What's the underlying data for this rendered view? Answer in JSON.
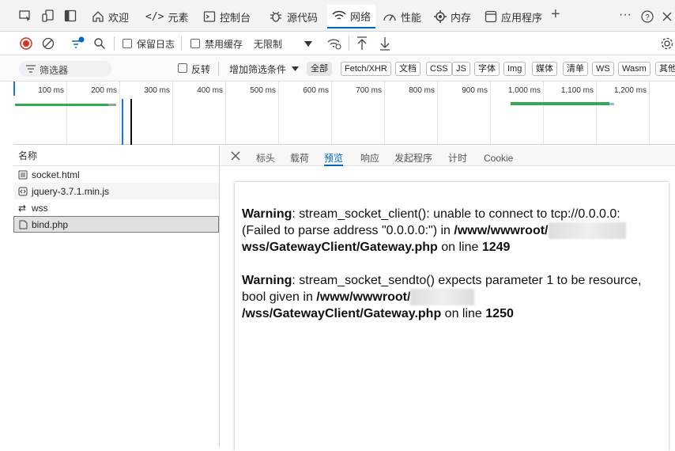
{
  "tabs": [
    {
      "label": "欢迎",
      "icon": "home-icon"
    },
    {
      "label": "元素",
      "icon": "code-icon"
    },
    {
      "label": "控制台",
      "icon": "console-icon"
    },
    {
      "label": "源代码",
      "icon": "bug-icon"
    },
    {
      "label": "网络",
      "icon": "wifi-icon",
      "active": true
    },
    {
      "label": "性能",
      "icon": "performance-icon"
    },
    {
      "label": "内存",
      "icon": "memory-icon"
    },
    {
      "label": "应用程序",
      "icon": "application-icon"
    }
  ],
  "toolbar": {
    "preserve_log": "保留日志",
    "disable_cache": "禁用缓存",
    "throttle": "无限制"
  },
  "filterbar": {
    "filter_placeholder": "筛选器",
    "invert": "反转",
    "more_filters": "增加筛选条件",
    "types": [
      "全部",
      "Fetch/XHR",
      "文档",
      "CSS",
      "JS",
      "字体",
      "Img",
      "媒体",
      "清单",
      "WS",
      "Wasm",
      "其他"
    ]
  },
  "timeline": {
    "ticks": [
      "100 ms",
      "200 ms",
      "300 ms",
      "400 ms",
      "500 ms",
      "600 ms",
      "700 ms",
      "800 ms",
      "900 ms",
      "1,000 ms",
      "1,100 ms",
      "1,200 ms"
    ]
  },
  "requests": {
    "header": "名称",
    "items": [
      {
        "name": "socket.html",
        "icon": "document-icon"
      },
      {
        "name": "jquery-3.7.1.min.js",
        "icon": "script-icon"
      },
      {
        "name": "wss",
        "icon": "websocket-icon"
      },
      {
        "name": "bind.php",
        "icon": "file-icon"
      }
    ]
  },
  "detail_tabs": [
    "标头",
    "载荷",
    "预览",
    "响应",
    "发起程序",
    "计时",
    "Cookie"
  ],
  "preview": {
    "w1_label": "Warning",
    "w1_text": ": stream_socket_client(): unable to connect to tcp://0.0.0.0: (Failed to parse address \"0.0.0.0:\") in",
    "w1_path_a": "/www/wwwroot/",
    "w1_path_b": "wss/GatewayClient/Gateway.php",
    "w1_on": " on line ",
    "w1_line": "1249",
    "w2_label": "Warning",
    "w2_text": ": stream_socket_sendto() expects parameter 1 to be resource, bool given in",
    "w2_path_a": "/www/wwwroot/",
    "w2_path_b": "/wss/GatewayClient/Gateway.php",
    "w2_on": " on line ",
    "w2_line": "1250"
  },
  "colors": {
    "accent": "#0067c0",
    "record": "#d93025",
    "timeline_green": "#34a853",
    "timeline_blue": "#1a73e8"
  }
}
